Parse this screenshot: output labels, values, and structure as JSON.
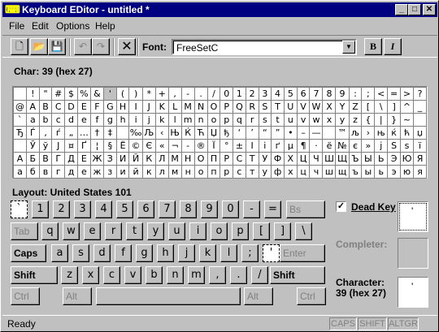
{
  "window": {
    "title": "Keyboard EDitor - untitled *",
    "min": "_",
    "max": "□",
    "close": "✕"
  },
  "menu": [
    "File",
    "Edit",
    "Options",
    "Help"
  ],
  "toolbar": {
    "font_label": "Font:",
    "font_value": "FreeSetC",
    "bold": "B",
    "italic": "I"
  },
  "char_info": "Char:  39 (hex 27)",
  "grid_rows": [
    [
      " ",
      "!",
      "\"",
      "#",
      "$",
      "%",
      "&",
      "'",
      "(",
      ")",
      "*",
      "+",
      ",",
      "-",
      ".",
      "/",
      "0",
      "1",
      "2",
      "3",
      "4",
      "5",
      "6",
      "7",
      "8",
      "9",
      ":",
      ";",
      "<",
      "=",
      ">",
      "?"
    ],
    [
      "@",
      "A",
      "B",
      "C",
      "D",
      "E",
      "F",
      "G",
      "H",
      "I",
      "J",
      "K",
      "L",
      "M",
      "N",
      "O",
      "P",
      "Q",
      "R",
      "S",
      "T",
      "U",
      "V",
      "W",
      "X",
      "Y",
      "Z",
      "[",
      "\\",
      "]",
      "^",
      "_"
    ],
    [
      "`",
      "a",
      "b",
      "c",
      "d",
      "e",
      "f",
      "g",
      "h",
      "i",
      "j",
      "k",
      "l",
      "m",
      "n",
      "o",
      "p",
      "q",
      "r",
      "s",
      "t",
      "u",
      "v",
      "w",
      "x",
      "y",
      "z",
      "{",
      "|",
      "}",
      "~",
      ""
    ],
    [
      "Ђ",
      "Ѓ",
      "‚",
      "ѓ",
      "„",
      "…",
      "†",
      "‡",
      "",
      "‰",
      "Љ",
      "‹",
      "Њ",
      "Ќ",
      "Ћ",
      "Џ",
      "ђ",
      "‘",
      "’",
      "“",
      "”",
      "•",
      "–",
      "—",
      "",
      "™",
      "љ",
      "›",
      "њ",
      "ќ",
      "ћ",
      "џ"
    ],
    [
      " ",
      "Ў",
      "ў",
      "Ј",
      "¤",
      "Ґ",
      "¦",
      "§",
      "Ё",
      "©",
      "Є",
      "«",
      "¬",
      "-",
      "®",
      "Ї",
      "°",
      "±",
      "І",
      "і",
      "ґ",
      "µ",
      "¶",
      "·",
      "ё",
      "№",
      "є",
      "»",
      "ј",
      "Ѕ",
      "ѕ",
      "ї"
    ],
    [
      "А",
      "Б",
      "В",
      "Г",
      "Д",
      "Е",
      "Ж",
      "З",
      "И",
      "Й",
      "К",
      "Л",
      "М",
      "Н",
      "О",
      "П",
      "Р",
      "С",
      "Т",
      "У",
      "Ф",
      "Х",
      "Ц",
      "Ч",
      "Ш",
      "Щ",
      "Ъ",
      "Ы",
      "Ь",
      "Э",
      "Ю",
      "Я"
    ],
    [
      "а",
      "б",
      "в",
      "г",
      "д",
      "е",
      "ж",
      "з",
      "и",
      "й",
      "к",
      "л",
      "м",
      "н",
      "о",
      "п",
      "р",
      "с",
      "т",
      "у",
      "ф",
      "х",
      "ц",
      "ч",
      "ш",
      "щ",
      "ъ",
      "ы",
      "ь",
      "э",
      "ю",
      "я"
    ]
  ],
  "layout_label": "Layout: United States 101",
  "keys": {
    "row1": [
      "`",
      "1",
      "2",
      "3",
      "4",
      "5",
      "6",
      "7",
      "8",
      "9",
      "0",
      "-",
      "=",
      "Bs"
    ],
    "row2": [
      "Tab",
      "q",
      "w",
      "e",
      "r",
      "t",
      "y",
      "u",
      "i",
      "o",
      "p",
      "[",
      "]",
      "\\"
    ],
    "row3": [
      "Caps",
      "a",
      "s",
      "d",
      "f",
      "g",
      "h",
      "j",
      "k",
      "l",
      ";",
      "'",
      "Enter"
    ],
    "row4": [
      "Shift",
      "z",
      "x",
      "c",
      "v",
      "b",
      "n",
      "m",
      ",",
      ".",
      "/",
      "Shift"
    ],
    "row5": [
      "Ctrl",
      "Alt",
      "Alt",
      "Ctrl"
    ]
  },
  "side": {
    "dead_key": "Dead Key",
    "dead_checked": "✓",
    "dead_char": "'",
    "completer": "Completer:",
    "character": "Character:",
    "char_value": "39 (hex 27)",
    "char_preview": "'"
  },
  "status": {
    "text": "Ready",
    "caps": "CAPS",
    "shift": "SHIFT",
    "altgr": "ALTGR"
  }
}
